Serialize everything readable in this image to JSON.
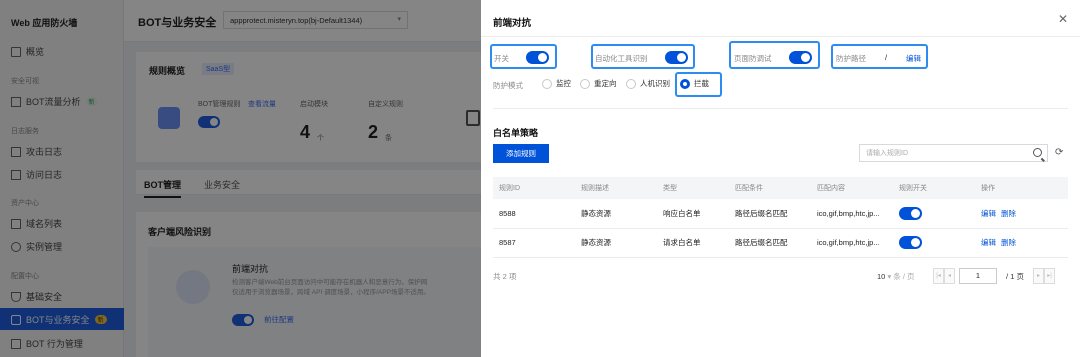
{
  "app": {
    "title": "Web 应用防火墙",
    "page_title": "BOT与业务安全",
    "instance_select": "appprotect.misteryn.top(bj-Default1344)"
  },
  "sidebar": {
    "overview": "概览",
    "group_security": "安全可视",
    "bot_traffic": "BOT流量分析",
    "bot_traffic_badge": "新",
    "group_logs": "日志服务",
    "attack_logs": "攻击日志",
    "access_logs": "访问日志",
    "group_assets": "资产中心",
    "domain_list": "域名列表",
    "instance_mgmt": "实例管理",
    "group_config": "配置中心",
    "basic_security": "基础安全",
    "bot_business": "BOT与业务安全",
    "bot_business_badge": "新",
    "bot_behavior": "BOT 行为管理"
  },
  "background": {
    "rules_overview": "规则概览",
    "saas_tag": "SaaS型",
    "bot_rule_label": "BOT管理规则",
    "view_traffic": "查看流量",
    "enabled_modules": "启动模块",
    "enabled_count": "4",
    "enabled_unit": "个",
    "custom_rules": "自定义规则",
    "custom_count": "2",
    "custom_unit": "条",
    "tab_bot": "BOT管理",
    "tab_business": "业务安全",
    "client_risk": "客户端风险识别",
    "frontend_title": "前端对抗",
    "frontend_desc1": "检测客户端Web前台页面访问中可能存在机器人和恶意行为，保护网",
    "frontend_desc2": "仅适用于浏览器场景，跨域 API 调度场景，小程序/APP场景不适用。",
    "frontend_link": "前往配置"
  },
  "drawer": {
    "title": "前端对抗",
    "switches": {
      "enable_label": "开关",
      "auto_tool_label": "自动化工具识别",
      "page_debug_label": "页面防调试",
      "protect_path_label": "防护路径",
      "protect_path_value": "/",
      "edit_label": "编辑"
    },
    "mode": {
      "label": "防护模式",
      "options": [
        "监控",
        "重定向",
        "人机识别",
        "拦截"
      ],
      "selected": "拦截"
    },
    "whitelist": {
      "title": "白名单策略",
      "add_button": "添加规则",
      "search_placeholder": "请输入规则ID",
      "columns": [
        "规则ID",
        "规则描述",
        "类型",
        "匹配条件",
        "匹配内容",
        "规则开关",
        "操作"
      ],
      "rows": [
        {
          "id": "8588",
          "desc": "静态资源",
          "type": "响应白名单",
          "cond": "路径后缀名匹配",
          "content": "ico,gif,bmp,htc,jp...",
          "enabled": true,
          "edit": "编辑",
          "delete": "删除"
        },
        {
          "id": "8587",
          "desc": "静态资源",
          "type": "请求白名单",
          "cond": "路径后缀名匹配",
          "content": "ico,gif,bmp,htc,jp...",
          "enabled": true,
          "edit": "编辑",
          "delete": "删除"
        }
      ]
    },
    "pagination": {
      "total": "共 2 项",
      "page_size": "10",
      "page_size_unit": "条 / 页",
      "current": "1",
      "total_pages": "/ 1 页"
    }
  },
  "colors": {
    "primary": "#0052d9",
    "highlight": "#2d8cf0"
  }
}
